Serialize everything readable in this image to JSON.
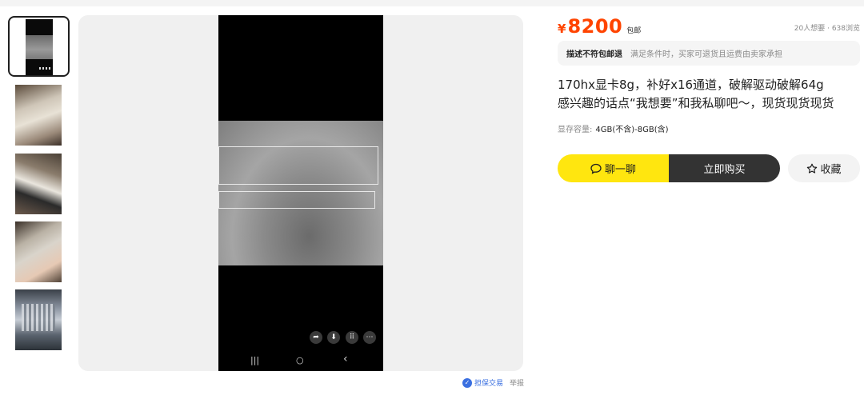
{
  "gallery": {
    "thumbnails": [
      {
        "label": "screen-photo",
        "selected": true
      },
      {
        "label": "gpu-photo-1",
        "selected": false
      },
      {
        "label": "gpu-photo-2",
        "selected": false
      },
      {
        "label": "gpu-photo-3",
        "selected": false
      },
      {
        "label": "gpu-photo-4",
        "selected": false
      }
    ],
    "phone_nav": {
      "recent": "|||",
      "home": "○",
      "back": "‹"
    },
    "overlay_icons": [
      "share-icon",
      "save-icon",
      "grid-icon",
      "more-icon"
    ]
  },
  "footer": {
    "guarantee": "担保交易",
    "report": "举报"
  },
  "product": {
    "currency": "¥",
    "price": "8200",
    "shipping": "包邮",
    "stats": "20人想要 · 638浏览",
    "policy_tag": "描述不符包邮退",
    "policy_desc": "满足条件时，买家可退货且运费由卖家承担",
    "title_line1": "170hx显卡8g，补好x16通道，破解驱动破解64g",
    "title_line2": "感兴趣的话点“我想要”和我私聊吧～，现货现货现货",
    "spec_label": "显存容量:",
    "spec_value": "4GB(不含)-8GB(含)"
  },
  "actions": {
    "chat": "聊一聊",
    "buy": "立即购买",
    "favorite": "收藏"
  },
  "colors": {
    "price": "#ff4400",
    "chat_button": "#ffe60f",
    "buy_button": "#333333",
    "guarantee": "#3a6fe0"
  }
}
